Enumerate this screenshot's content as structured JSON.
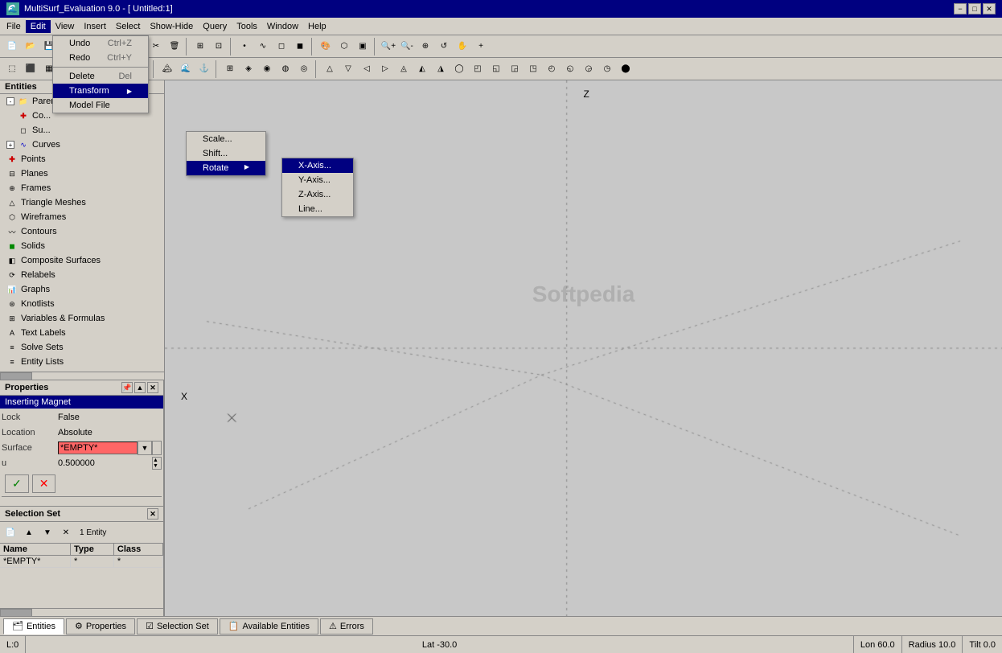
{
  "app": {
    "title": "MultiSurf_Evaluation 9.0 - [ Untitled:1]"
  },
  "titlebar": {
    "minimize": "−",
    "maximize": "□",
    "close": "✕"
  },
  "menubar": {
    "items": [
      "File",
      "Edit",
      "View",
      "Insert",
      "Select",
      "Show-Hide",
      "Query",
      "Tools",
      "Window",
      "Help"
    ]
  },
  "edit_menu": {
    "items": [
      {
        "label": "Undo",
        "shortcut": "Ctrl+Z",
        "enabled": true
      },
      {
        "label": "Redo",
        "shortcut": "Ctrl+Y",
        "enabled": true
      },
      {
        "label": "Delete",
        "shortcut": "Del",
        "enabled": true
      },
      {
        "label": "Transform",
        "hasSubmenu": true,
        "active": true
      },
      {
        "label": "Model File",
        "hasSubmenu": false
      }
    ]
  },
  "transform_menu": {
    "items": [
      {
        "label": "Scale...",
        "active": false
      },
      {
        "label": "Shift...",
        "active": false
      },
      {
        "label": "Rotate",
        "hasSubmenu": true,
        "active": true
      }
    ]
  },
  "rotate_menu": {
    "items": [
      {
        "label": "X-Axis...",
        "active": true
      },
      {
        "label": "Y-Axis...",
        "active": false
      },
      {
        "label": "Z-Axis...",
        "active": false
      },
      {
        "label": "Line...",
        "active": false
      }
    ]
  },
  "entities_panel": {
    "title": "Entities",
    "items": [
      {
        "label": "Parents",
        "indent": 0,
        "icon": "tree",
        "expandable": true,
        "expanded": true
      },
      {
        "label": "Co...",
        "indent": 1,
        "icon": "cross"
      },
      {
        "label": "Su...",
        "indent": 1,
        "icon": "surface"
      },
      {
        "label": "Curves",
        "indent": 0,
        "icon": "curve",
        "expandable": true
      },
      {
        "label": "Points",
        "indent": 0,
        "icon": "point",
        "expandable": false
      },
      {
        "label": "Planes",
        "indent": 0,
        "icon": "plane"
      },
      {
        "label": "Frames",
        "indent": 0,
        "icon": "frame"
      },
      {
        "label": "Triangle Meshes",
        "indent": 0,
        "icon": "triangle"
      },
      {
        "label": "Wireframes",
        "indent": 0,
        "icon": "wire"
      },
      {
        "label": "Contours",
        "indent": 0,
        "icon": "contour"
      },
      {
        "label": "Solids",
        "indent": 0,
        "icon": "solid"
      },
      {
        "label": "Composite Surfaces",
        "indent": 0,
        "icon": "composite"
      },
      {
        "label": "Relabels",
        "indent": 0,
        "icon": "relabel"
      },
      {
        "label": "Graphs",
        "indent": 0,
        "icon": "graph"
      },
      {
        "label": "Knotlists",
        "indent": 0,
        "icon": "knot"
      },
      {
        "label": "Variables & Formulas",
        "indent": 0,
        "icon": "var"
      },
      {
        "label": "Text Labels",
        "indent": 0,
        "icon": "text"
      },
      {
        "label": "Solve Sets",
        "indent": 0,
        "icon": "solve"
      },
      {
        "label": "Entity Lists",
        "indent": 0,
        "icon": "list"
      }
    ]
  },
  "properties_panel": {
    "title": "Properties",
    "entity_title": "Inserting Magnet",
    "rows": [
      {
        "label": "Lock",
        "value": "False"
      },
      {
        "label": "Location",
        "value": "Absolute"
      },
      {
        "label": "Surface",
        "value": "*EMPTY*",
        "type": "input-red"
      },
      {
        "label": "u",
        "value": "0.500000"
      }
    ],
    "confirm_label": "✓",
    "cancel_label": "✕"
  },
  "selection_panel": {
    "title": "Selection Set",
    "count_label": "1 Entity",
    "toolbar_buttons": [
      "new",
      "up",
      "down",
      "delete",
      "count"
    ],
    "columns": [
      "Name",
      "Type",
      "Class"
    ],
    "rows": [
      {
        "name": "*EMPTY*",
        "type": "*",
        "class": "*"
      }
    ]
  },
  "canvas": {
    "label_z": "Z",
    "label_x": "X",
    "watermark": "Softpedia"
  },
  "status_bar": {
    "l_label": "L:0",
    "lat_label": "Lat -30.0",
    "lon_label": "Lon 60.0",
    "radius_label": "Radius 10.0",
    "tilt_label": "Tilt 0.0"
  },
  "tabs": [
    {
      "label": "Entities",
      "icon": "entities-icon"
    },
    {
      "label": "Properties",
      "icon": "properties-icon"
    },
    {
      "label": "Selection Set",
      "icon": "selection-icon"
    },
    {
      "label": "Available Entities",
      "icon": "available-icon"
    },
    {
      "label": "Errors",
      "icon": "errors-icon"
    }
  ],
  "icons": {
    "search": "🔍",
    "gear": "⚙",
    "close": "✕",
    "up": "▲",
    "down": "▼",
    "new": "📄",
    "delete": "✕"
  }
}
